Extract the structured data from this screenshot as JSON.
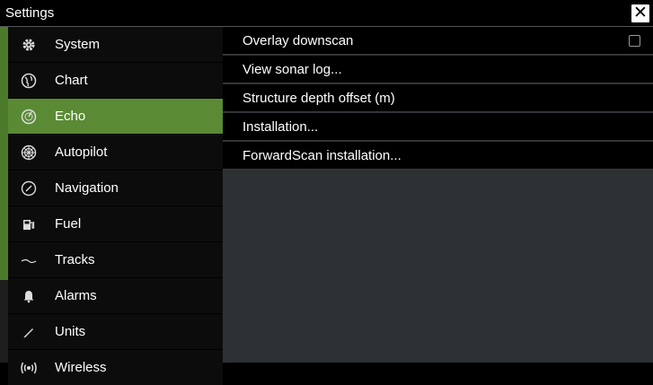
{
  "window": {
    "title": "Settings",
    "close_icon": "close-icon"
  },
  "sidebar": {
    "accent_color": "#5a8a34",
    "selected": "Echo",
    "items": [
      {
        "label": "System",
        "icon": "gear-icon"
      },
      {
        "label": "Chart",
        "icon": "globe-icon"
      },
      {
        "label": "Echo",
        "icon": "sonar-icon"
      },
      {
        "label": "Autopilot",
        "icon": "helm-icon"
      },
      {
        "label": "Navigation",
        "icon": "compass-icon"
      },
      {
        "label": "Fuel",
        "icon": "fuel-icon"
      },
      {
        "label": "Tracks",
        "icon": "tracks-icon"
      },
      {
        "label": "Alarms",
        "icon": "bell-icon"
      },
      {
        "label": "Units",
        "icon": "pencil-icon"
      },
      {
        "label": "Wireless",
        "icon": "wireless-icon"
      }
    ]
  },
  "echo_settings": {
    "rows": [
      {
        "label": "Overlay downscan",
        "control": "checkbox",
        "checked": false
      },
      {
        "label": "View sonar log..."
      },
      {
        "label": "Structure depth offset (m)"
      },
      {
        "label": "Installation..."
      },
      {
        "label": "ForwardScan installation..."
      }
    ]
  }
}
